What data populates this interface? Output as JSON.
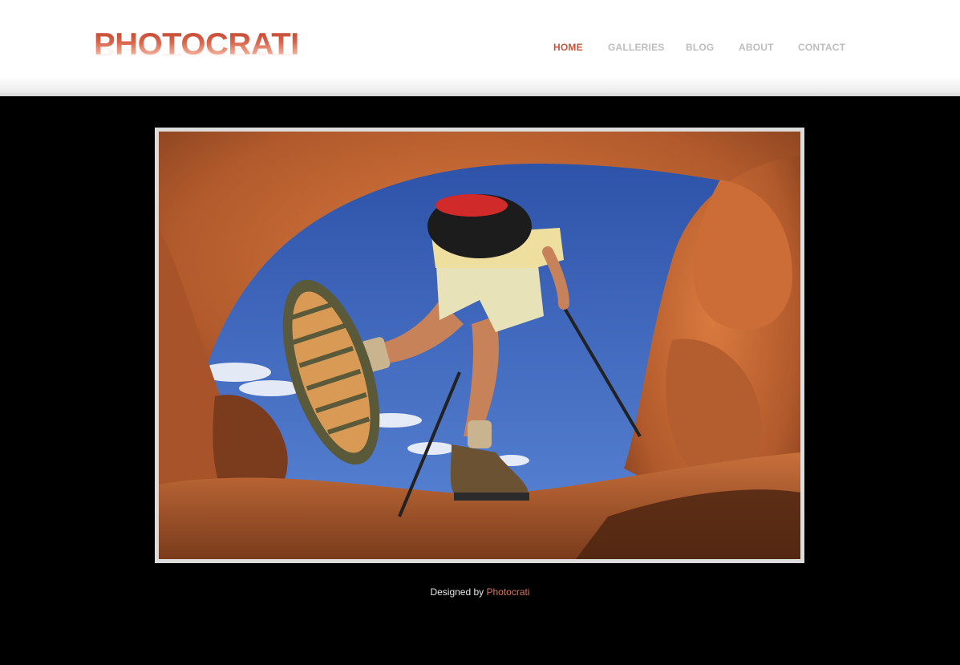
{
  "brand": {
    "logo_text": "PHOTOCRATI"
  },
  "nav": {
    "items": [
      {
        "label": "HOME",
        "active": true
      },
      {
        "label": "GALLERIES",
        "active": false
      },
      {
        "label": "BLOG",
        "active": false
      },
      {
        "label": "ABOUT",
        "active": false
      },
      {
        "label": "CONTACT",
        "active": false
      }
    ]
  },
  "hero": {
    "image_subject": "hiker-under-rock-arch"
  },
  "footer": {
    "prefix": "Designed by",
    "link_label": "Photocrati"
  },
  "colors": {
    "accent": "#c6553e",
    "nav_inactive": "#bdbdbd",
    "page_background": "#000000",
    "frame_border": "#dcdcdc"
  }
}
